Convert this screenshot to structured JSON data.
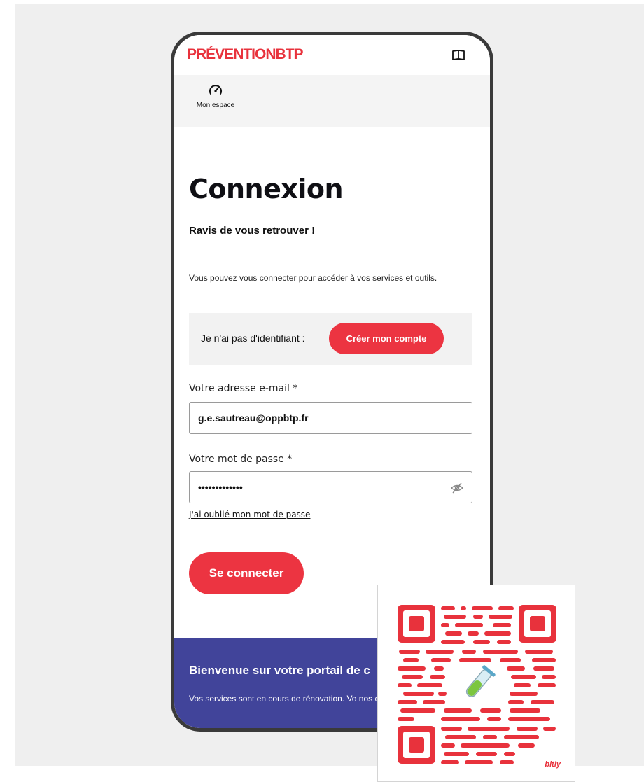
{
  "header": {
    "logo_part1": "PRÉVENTION",
    "logo_part2": "BTP",
    "book_icon": "book-open-icon"
  },
  "nav": {
    "items": [
      {
        "label": "Mon espace",
        "icon": "gauge-icon"
      }
    ]
  },
  "login": {
    "title": "Connexion",
    "subtitle": "Ravis de vous retrouver !",
    "description": "Vous pouvez vous connecter pour accéder à vos services et outils.",
    "no_account_text": "Je n'ai pas d'identifiant :",
    "create_account_label": "Créer mon compte",
    "email_label": "Votre adresse e-mail *",
    "email_value": "g.e.sautreau@oppbtp.fr",
    "password_label": "Votre mot de passe *",
    "password_value": "•••••••••••••",
    "forgot_label": "J'ai oublié mon mot de passe",
    "submit_label": "Se connecter"
  },
  "footer": {
    "title": "Bienvenue sur votre portail de c",
    "text": "Vos services sont en cours de rénovation. Vo nos chantiers :"
  },
  "qr": {
    "brand": "bitly",
    "center_icon": "test-tube-icon"
  },
  "colors": {
    "accent": "#ec3441",
    "footer_bg": "#41449a",
    "backdrop": "#efefef"
  }
}
